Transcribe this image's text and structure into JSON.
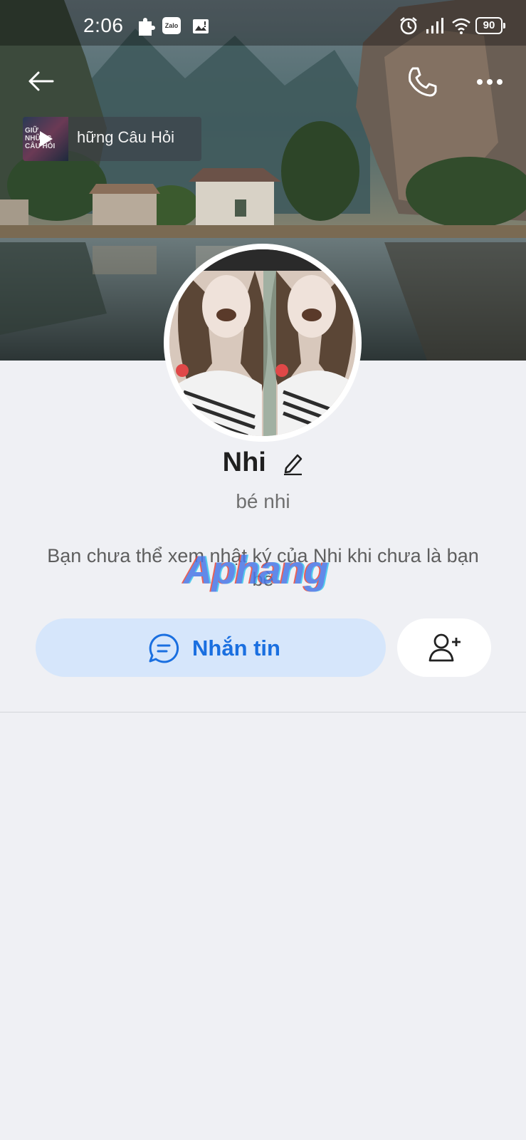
{
  "statusbar": {
    "time": "2:06",
    "left_icons": [
      "puzzle-icon",
      "zalo-app-icon",
      "gallery-icon"
    ],
    "zalo_label": "Zalo",
    "right_icons": [
      "alarm-icon",
      "signal-icon",
      "wifi-icon"
    ],
    "battery": "90"
  },
  "header": {
    "back_icon": "arrow-left-icon",
    "call_icon": "phone-icon",
    "more_icon": "more-horizontal-icon"
  },
  "music": {
    "title": "hững Câu Hỏi",
    "thumb_text": "GIỮ\nNHỮNG\nCÂU HỎI"
  },
  "profile": {
    "name": "Nhi",
    "nickname": "bé nhi",
    "notice": "Bạn chưa thể xem nhật ký của Nhi khi chưa là bạn bè",
    "watermark": "Aphang"
  },
  "actions": {
    "message_label": "Nhắn tin",
    "message_icon": "chat-bubble-icon",
    "add_friend_icon": "add-user-icon"
  },
  "colors": {
    "background": "#eff0f4",
    "primary": "#1a6fe0",
    "message_button_bg": "#d6e6fb"
  }
}
